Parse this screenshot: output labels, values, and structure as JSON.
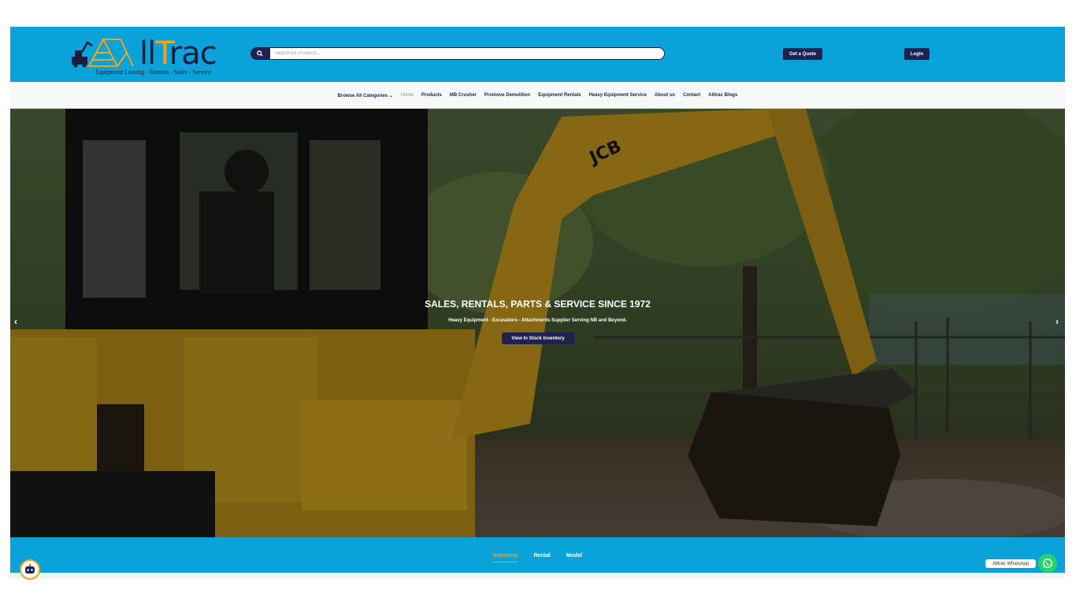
{
  "brand": {
    "logo_word_prefix": "ll",
    "logo_word_suffix": "rac",
    "logo_word_t": "T",
    "tagline": "Equipment Leasing - Rentals - Sales - Service",
    "accent": "#0aa3d9",
    "navy": "#1f2150",
    "orange": "#f0a41c"
  },
  "search": {
    "placeholder": "Search for Products...",
    "icon": "search-icon"
  },
  "header": {
    "quote_label": "Get a Quote",
    "login_label": "Login"
  },
  "nav": {
    "items": [
      "Browse All Categories ⌄",
      "Home",
      "Products",
      "MB Crusher",
      "Promove Demolition",
      "Equipment Rentals",
      "Heavy Equipment Service",
      "About us",
      "Contact",
      "Alltrac Blogs"
    ],
    "active_index": 1
  },
  "hero": {
    "title": "SALES, RENTALS, PARTS & SERVICE SINCE 1972",
    "subtitle": "Heavy Equipment - Excavators - Attachments Supplier Serving NB and Beyond.",
    "cta": "View In Stock Inventory",
    "excavator_brand": "JCB",
    "prev_arrow": "‹",
    "next_arrow": "›"
  },
  "tabs": {
    "items": [
      "Inventory",
      "Rental",
      "Model"
    ],
    "active_index": 0
  },
  "widgets": {
    "whatsapp_label": "Alltrac WhatsApp",
    "chatbot_icon": "robot-icon",
    "whatsapp_icon": "whatsapp-icon"
  }
}
